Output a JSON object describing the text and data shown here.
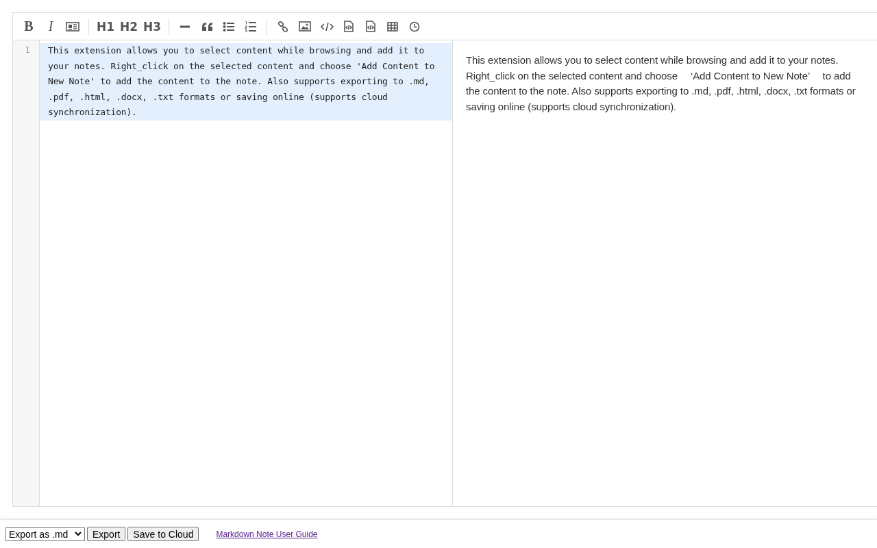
{
  "toolbar": {
    "groups": [
      [
        {
          "kind": "bold",
          "label": "B"
        },
        {
          "kind": "italic",
          "label": "I"
        },
        {
          "kind": "newspaper"
        }
      ],
      [
        {
          "kind": "heading",
          "label": "H1"
        },
        {
          "kind": "heading",
          "label": "H2"
        },
        {
          "kind": "heading",
          "label": "H3"
        }
      ],
      [
        {
          "kind": "rule"
        },
        {
          "kind": "quote"
        },
        {
          "kind": "bullets"
        },
        {
          "kind": "numbers"
        }
      ],
      [
        {
          "kind": "link"
        },
        {
          "kind": "image"
        },
        {
          "kind": "code"
        },
        {
          "kind": "filecode"
        },
        {
          "kind": "filecode"
        },
        {
          "kind": "table"
        },
        {
          "kind": "clock"
        }
      ]
    ]
  },
  "editor": {
    "lines": [
      {
        "number": "1",
        "text": "This extension allows you to select content while browsing and add it to your notes. Right_click on the selected content and choose 'Add Content to New Note' to add the content to the note. Also supports exporting to .md, .pdf, .html, .docx, .txt formats or saving online (supports cloud synchronization).",
        "selected": true
      }
    ]
  },
  "preview": {
    "paragraphs": [
      "This extension allows you to select content while browsing and add it to your notes. Right_click on the selected content and choose 　‘Add Content to New Note’　 to add the content to the note. Also supports exporting to .md, .pdf, .html, .docx, .txt formats or saving online (supports cloud synchronization)."
    ]
  },
  "footer": {
    "export_select": {
      "value": "Export as .md"
    },
    "buttons": [
      "Export",
      "Save to Cloud"
    ],
    "link": {
      "label": "Markdown Note User Guide",
      "visited": true
    }
  }
}
